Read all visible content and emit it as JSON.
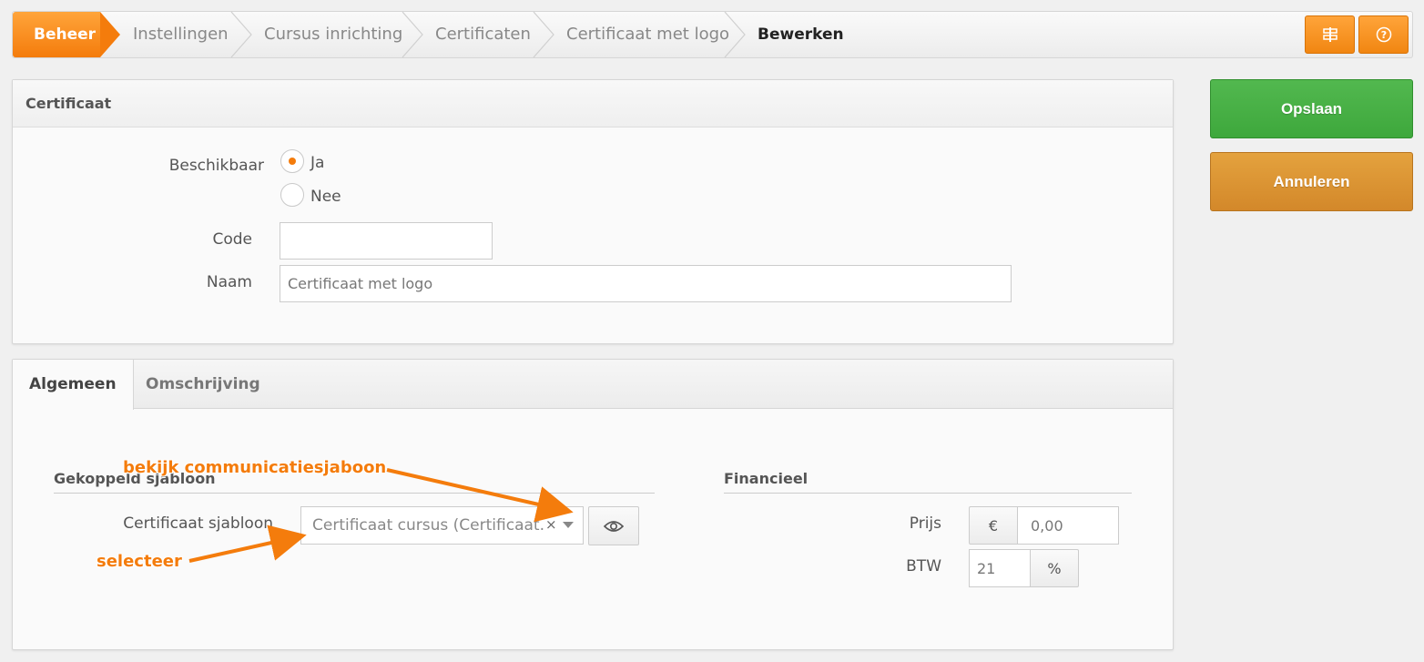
{
  "colors": {
    "accent": "#f47c0c",
    "save": "#3ea83c",
    "cancel": "#d98f2b"
  },
  "breadcrumb": {
    "home": "Beheer",
    "items": [
      "Instellingen",
      "Cursus inrichting",
      "Certificaten",
      "Certificaat met logo"
    ],
    "current": "Bewerken",
    "icons": [
      "signpost-icon",
      "help-icon"
    ]
  },
  "certificate_panel": {
    "title": "Certificaat",
    "available_label": "Beschikbaar",
    "options": [
      "Ja",
      "Nee"
    ],
    "selected": "Ja",
    "code_label": "Code",
    "code_value": "",
    "name_label": "Naam",
    "name_value": "Certificaat met logo"
  },
  "tabs": {
    "items": [
      "Algemeen",
      "Omschrijving"
    ],
    "active": "Algemeen"
  },
  "linked_template": {
    "section_title": "Gekoppeld sjabloon",
    "template_label": "Certificaat sjabloon",
    "template_value": "Certificaat cursus (Certificaat...",
    "clear_symbol": "×",
    "view_icon": "eye-icon"
  },
  "financial": {
    "section_title": "Financieel",
    "price_label": "Prijs",
    "currency": "€",
    "price_value": "0,00",
    "vat_label": "BTW",
    "vat_value": "21",
    "percent": "%"
  },
  "actions": {
    "save": "Opslaan",
    "cancel": "Annuleren"
  },
  "annotations": {
    "view": "bekijk communicatiesjaboon",
    "select": "selecteer"
  }
}
